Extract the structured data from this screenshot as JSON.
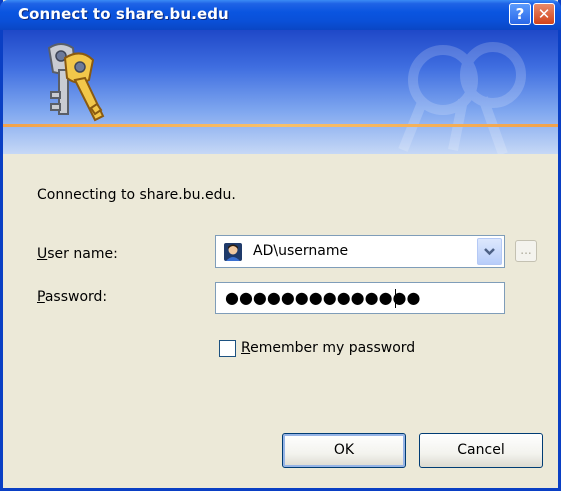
{
  "window": {
    "title": "Connect to share.bu.edu",
    "help_label": "?",
    "close_label": "✕"
  },
  "icons": {
    "banner": "keys-icon",
    "user": "user-account-icon",
    "dropdown": "chevron-down-icon"
  },
  "dialog": {
    "connecting_text": "Connecting to share.bu.edu."
  },
  "username": {
    "label_prefix": "U",
    "label_rest": "ser name:",
    "value": "AD\\username",
    "browse_label": "..."
  },
  "password": {
    "label_prefix": "P",
    "label_rest": "assword:",
    "masked_value": "●●●●●●●●●●●●●●"
  },
  "remember": {
    "label_prefix": "R",
    "label_rest": "emember my password",
    "checked": false
  },
  "buttons": {
    "ok_label": "OK",
    "cancel_label": "Cancel"
  },
  "colors": {
    "title_bar": "#0a55e0",
    "dialog_bg": "#ece9d8",
    "accent_line": "#f2a24a"
  }
}
